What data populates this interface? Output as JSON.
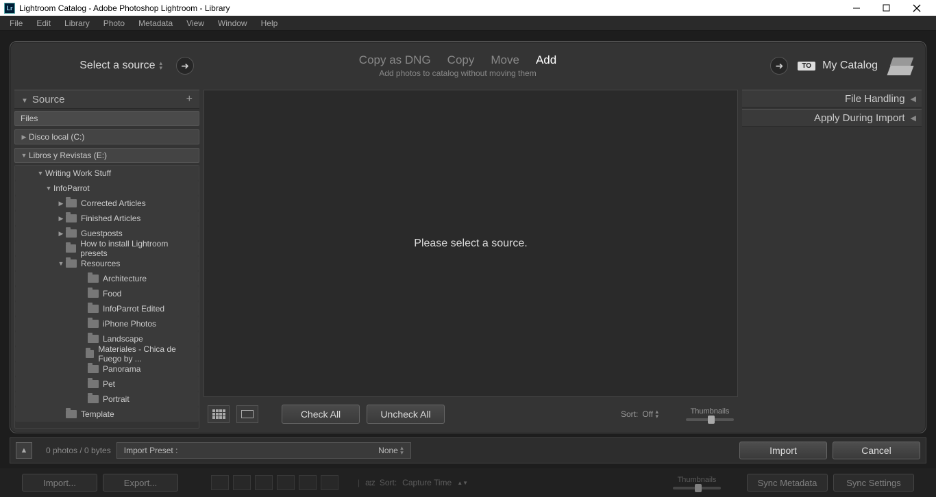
{
  "titlebar": {
    "title": "Lightroom Catalog - Adobe Photoshop Lightroom - Library",
    "icon": "Lr"
  },
  "menu": {
    "items": [
      "File",
      "Edit",
      "Library",
      "Photo",
      "Metadata",
      "View",
      "Window",
      "Help"
    ]
  },
  "header": {
    "source_label": "Select a source",
    "modes": {
      "copy_dng": "Copy as DNG",
      "copy": "Copy",
      "move": "Move",
      "add": "Add"
    },
    "mode_desc": "Add photos to catalog without moving them",
    "to_badge": "TO",
    "dest_label": "My Catalog"
  },
  "source_panel": {
    "title": "Source",
    "files_label": "Files",
    "drives": [
      {
        "label": "Disco local (C:)",
        "expanded": false
      },
      {
        "label": "Libros y Revistas (E:)",
        "expanded": true
      }
    ],
    "tree": [
      {
        "indent": 3,
        "label": "Writing Work Stuff",
        "tri": "▼",
        "icon": false
      },
      {
        "indent": 4,
        "label": "InfoParrot",
        "tri": "▼",
        "icon": false
      },
      {
        "indent": 5,
        "label": "Corrected Articles",
        "tri": "▶",
        "icon": true
      },
      {
        "indent": 5,
        "label": "Finished Articles",
        "tri": "▶",
        "icon": true
      },
      {
        "indent": 5,
        "label": "Guestposts",
        "tri": "▶",
        "icon": true
      },
      {
        "indent": 5,
        "label": "How to install Lightroom presets",
        "tri": "",
        "icon": true
      },
      {
        "indent": 5,
        "label": "Resources",
        "tri": "▼",
        "icon": true
      },
      {
        "indent": 6,
        "label": "Architecture",
        "tri": "",
        "icon": true
      },
      {
        "indent": 6,
        "label": "Food",
        "tri": "",
        "icon": true
      },
      {
        "indent": 6,
        "label": "InfoParrot Edited",
        "tri": "",
        "icon": true
      },
      {
        "indent": 6,
        "label": "iPhone Photos",
        "tri": "",
        "icon": true
      },
      {
        "indent": 6,
        "label": "Landscape",
        "tri": "",
        "icon": true
      },
      {
        "indent": 6,
        "label": "Materiales - Chica de Fuego by ...",
        "tri": "",
        "icon": true
      },
      {
        "indent": 6,
        "label": "Panorama",
        "tri": "",
        "icon": true
      },
      {
        "indent": 6,
        "label": "Pet",
        "tri": "",
        "icon": true
      },
      {
        "indent": 6,
        "label": "Portrait",
        "tri": "",
        "icon": true
      },
      {
        "indent": 5,
        "label": "Template",
        "tri": "",
        "icon": true
      }
    ]
  },
  "preview": {
    "message": "Please select a source."
  },
  "center_foot": {
    "check_all": "Check All",
    "uncheck_all": "Uncheck All",
    "sort_label": "Sort:",
    "sort_value": "Off",
    "thumb_label": "Thumbnails"
  },
  "right_panels": {
    "file_handling": "File Handling",
    "apply_during": "Apply During Import"
  },
  "footer": {
    "status": "0 photos / 0 bytes",
    "preset_label": "Import Preset :",
    "preset_value": "None",
    "import_btn": "Import",
    "cancel_btn": "Cancel"
  },
  "bg_bar": {
    "import": "Import...",
    "export": "Export...",
    "sort_label": "Sort:",
    "sort_value": "Capture Time",
    "thumb_label": "Thumbnails",
    "sync_meta": "Sync Metadata",
    "sync_settings": "Sync Settings"
  }
}
